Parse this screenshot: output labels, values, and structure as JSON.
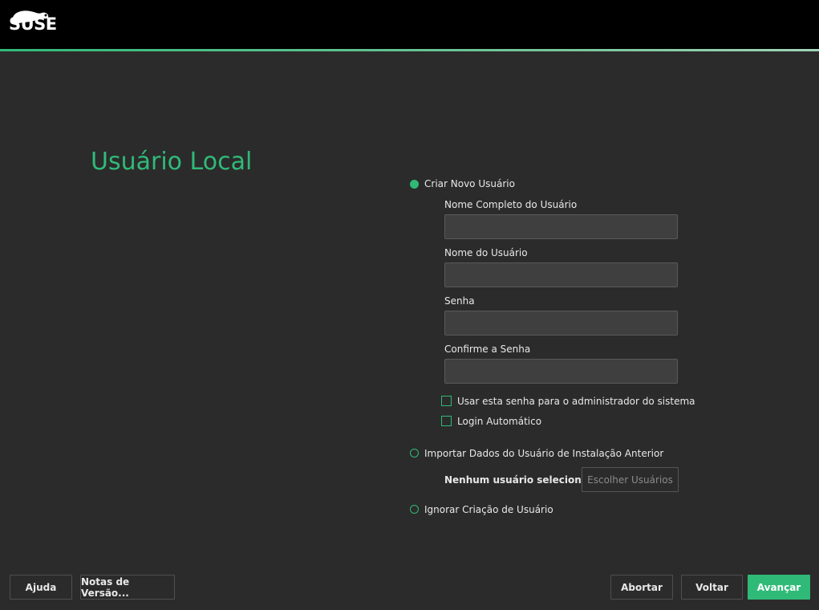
{
  "header": {
    "logo_text": "SUSE"
  },
  "page_title": "Usuário Local",
  "options": {
    "create_new_user": {
      "label": "Criar Novo Usuário",
      "selected": true,
      "full_name_label": "Nome Completo do Usuário",
      "full_name_value": "",
      "username_label": "Nome do Usuário",
      "username_value": "",
      "password_label": "Senha",
      "password_value": "",
      "confirm_password_label": "Confirme a Senha",
      "confirm_password_value": "",
      "use_password_for_admin_label": "Usar esta senha para o administrador do sistema",
      "use_password_for_admin_checked": false,
      "auto_login_label": "Login Automático",
      "auto_login_checked": false
    },
    "import_users": {
      "label": "Importar Dados do Usuário de Instalação Anterior",
      "selected": false,
      "status_text": "Nenhum usuário selecionado",
      "choose_button_label": "Escolher Usuários"
    },
    "skip_user_creation": {
      "label": "Ignorar Criação de Usuário",
      "selected": false
    }
  },
  "footer": {
    "help_label": "Ajuda",
    "release_notes_label": "Notas de Versão...",
    "abort_label": "Abortar",
    "back_label": "Voltar",
    "next_label": "Avançar"
  },
  "colors": {
    "accent": "#30ba78",
    "background": "#2b2b2b",
    "header": "#000000"
  }
}
